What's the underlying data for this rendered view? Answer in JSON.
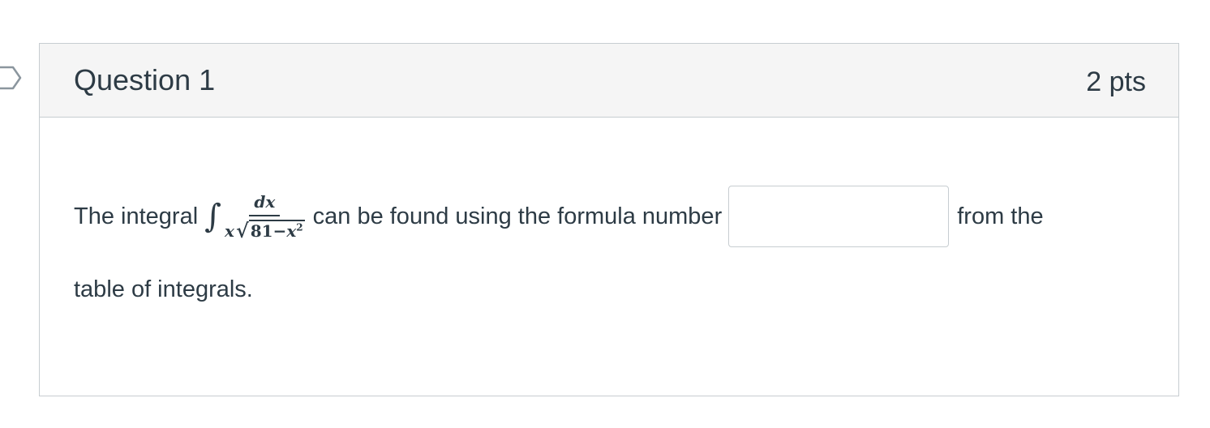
{
  "question": {
    "title": "Question 1",
    "points": "2 pts",
    "text_before": "The integral",
    "integral": {
      "sign": "∫",
      "numerator": "dx",
      "den_x": "x",
      "root_symbol": "√",
      "radicand_number": "81",
      "radicand_minus": "−",
      "radicand_var": "x",
      "radicand_exp": "2"
    },
    "text_middle": "can be found using the formula number",
    "answer_value": "",
    "text_after": "from the",
    "text_line2": "table of integrals."
  },
  "colors": {
    "text": "#2d3b45",
    "header_bg": "#f5f5f5",
    "border": "#c7cdd1"
  },
  "icons": {
    "flag": "flag-question-icon"
  }
}
